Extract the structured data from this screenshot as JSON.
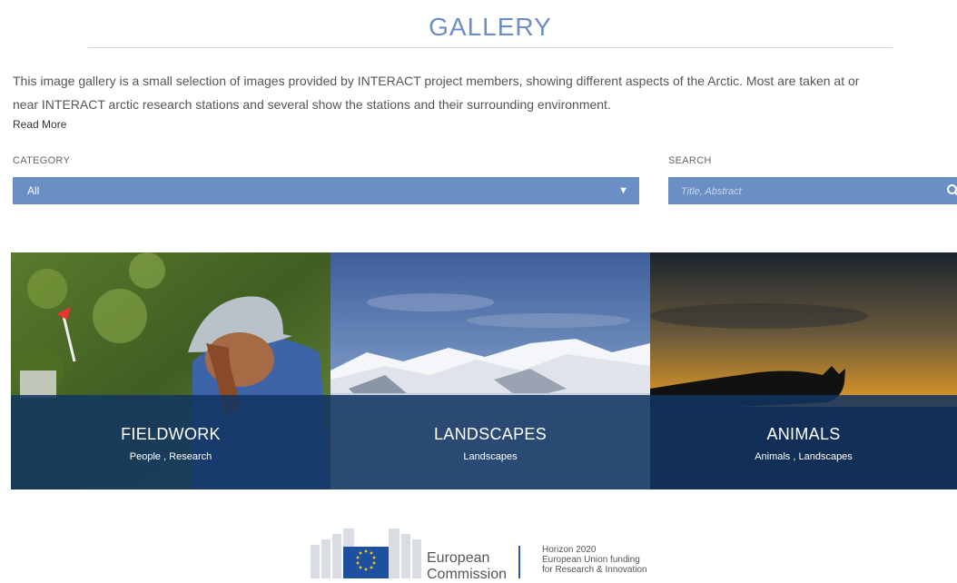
{
  "header": {
    "title": "GALLERY"
  },
  "intro": {
    "line1": "This image gallery is a small selection of images provided by INTERACT project members, showing different aspects of the Arctic. Most are taken at or",
    "line2": "near INTERACT arctic research stations and several show the stations and their surrounding environment.",
    "read_more": "Read More"
  },
  "filters": {
    "category_label": "CATEGORY",
    "category_value": "All",
    "search_label": "SEARCH",
    "search_placeholder": "Title, Abstract"
  },
  "tiles": [
    {
      "title": "FIELDWORK",
      "subtitle": "People , Research"
    },
    {
      "title": "LANDSCAPES",
      "subtitle": "Landscapes"
    },
    {
      "title": "ANIMALS",
      "subtitle": "Animals , Landscapes"
    }
  ],
  "footer": {
    "ec_line1": "European",
    "ec_line2": "Commission",
    "h2020_line1": "Horizon 2020",
    "h2020_line2": "European Union funding",
    "h2020_line3": "for Research & Innovation"
  },
  "colors": {
    "accent": "#6b8ec4",
    "overlay": "#123462"
  },
  "icons": {
    "search": "search-icon",
    "dropdown": "triangle-down-icon",
    "eu_flag": "eu-flag-icon"
  }
}
